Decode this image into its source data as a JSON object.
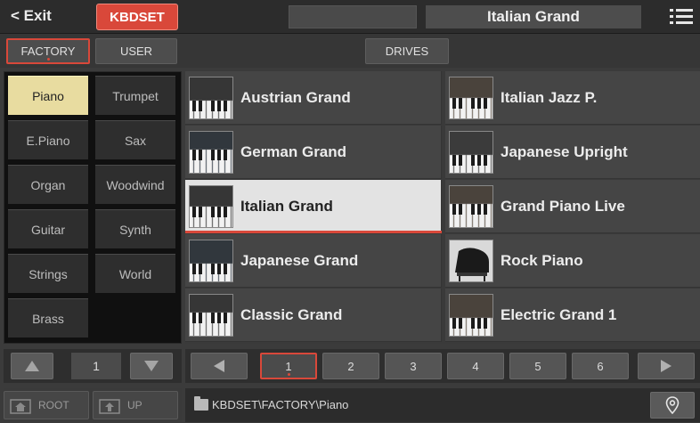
{
  "topbar": {
    "exit_label": "< Exit",
    "mode_label": "KBDSET",
    "current_sound": "Italian Grand"
  },
  "tabs": {
    "factory": "FACTORY",
    "user": "USER",
    "drives": "DRIVES"
  },
  "categories": [
    {
      "label": "Piano",
      "selected": true
    },
    {
      "label": "Trumpet",
      "selected": false
    },
    {
      "label": "E.Piano",
      "selected": false
    },
    {
      "label": "Sax",
      "selected": false
    },
    {
      "label": "Organ",
      "selected": false
    },
    {
      "label": "Woodwind",
      "selected": false
    },
    {
      "label": "Guitar",
      "selected": false
    },
    {
      "label": "Synth",
      "selected": false
    },
    {
      "label": "Strings",
      "selected": false
    },
    {
      "label": "World",
      "selected": false
    },
    {
      "label": "Brass",
      "selected": false
    }
  ],
  "sounds": [
    {
      "name": "Austrian Grand",
      "icon": "piano-keys-icon",
      "selected": false
    },
    {
      "name": "Italian Jazz P.",
      "icon": "piano-keys-icon",
      "selected": false
    },
    {
      "name": "German Grand",
      "icon": "piano-keys-icon",
      "selected": false
    },
    {
      "name": "Japanese Upright",
      "icon": "piano-keys-icon",
      "selected": false
    },
    {
      "name": "Italian Grand",
      "icon": "piano-keys-icon",
      "selected": true
    },
    {
      "name": "Grand Piano Live",
      "icon": "piano-keys-icon",
      "selected": false
    },
    {
      "name": "Japanese Grand",
      "icon": "piano-keys-icon",
      "selected": false
    },
    {
      "name": "Rock Piano",
      "icon": "grand-piano-icon",
      "selected": false
    },
    {
      "name": "Classic Grand",
      "icon": "piano-keys-icon",
      "selected": false
    },
    {
      "name": "Electric Grand 1",
      "icon": "piano-keys-icon",
      "selected": false
    }
  ],
  "category_nav": {
    "page": "1"
  },
  "pages": [
    "1",
    "2",
    "3",
    "4",
    "5",
    "6"
  ],
  "current_page": "1",
  "footer": {
    "root_label": "ROOT",
    "up_label": "UP",
    "path": "KBDSET\\FACTORY\\Piano"
  },
  "colors": {
    "accent": "#d9483a",
    "selected_category": "#e8dca0",
    "selected_sound": "#e3e3e3"
  }
}
